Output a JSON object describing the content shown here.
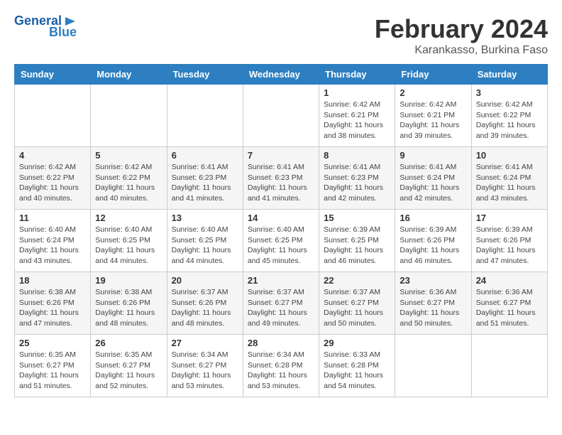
{
  "header": {
    "logo_line1": "General",
    "logo_line2": "Blue",
    "title": "February 2024",
    "subtitle": "Karankasso, Burkina Faso"
  },
  "weekdays": [
    "Sunday",
    "Monday",
    "Tuesday",
    "Wednesday",
    "Thursday",
    "Friday",
    "Saturday"
  ],
  "weeks": [
    [
      {
        "day": "",
        "info": ""
      },
      {
        "day": "",
        "info": ""
      },
      {
        "day": "",
        "info": ""
      },
      {
        "day": "",
        "info": ""
      },
      {
        "day": "1",
        "info": "Sunrise: 6:42 AM\nSunset: 6:21 PM\nDaylight: 11 hours\nand 38 minutes."
      },
      {
        "day": "2",
        "info": "Sunrise: 6:42 AM\nSunset: 6:21 PM\nDaylight: 11 hours\nand 39 minutes."
      },
      {
        "day": "3",
        "info": "Sunrise: 6:42 AM\nSunset: 6:22 PM\nDaylight: 11 hours\nand 39 minutes."
      }
    ],
    [
      {
        "day": "4",
        "info": "Sunrise: 6:42 AM\nSunset: 6:22 PM\nDaylight: 11 hours\nand 40 minutes."
      },
      {
        "day": "5",
        "info": "Sunrise: 6:42 AM\nSunset: 6:22 PM\nDaylight: 11 hours\nand 40 minutes."
      },
      {
        "day": "6",
        "info": "Sunrise: 6:41 AM\nSunset: 6:23 PM\nDaylight: 11 hours\nand 41 minutes."
      },
      {
        "day": "7",
        "info": "Sunrise: 6:41 AM\nSunset: 6:23 PM\nDaylight: 11 hours\nand 41 minutes."
      },
      {
        "day": "8",
        "info": "Sunrise: 6:41 AM\nSunset: 6:23 PM\nDaylight: 11 hours\nand 42 minutes."
      },
      {
        "day": "9",
        "info": "Sunrise: 6:41 AM\nSunset: 6:24 PM\nDaylight: 11 hours\nand 42 minutes."
      },
      {
        "day": "10",
        "info": "Sunrise: 6:41 AM\nSunset: 6:24 PM\nDaylight: 11 hours\nand 43 minutes."
      }
    ],
    [
      {
        "day": "11",
        "info": "Sunrise: 6:40 AM\nSunset: 6:24 PM\nDaylight: 11 hours\nand 43 minutes."
      },
      {
        "day": "12",
        "info": "Sunrise: 6:40 AM\nSunset: 6:25 PM\nDaylight: 11 hours\nand 44 minutes."
      },
      {
        "day": "13",
        "info": "Sunrise: 6:40 AM\nSunset: 6:25 PM\nDaylight: 11 hours\nand 44 minutes."
      },
      {
        "day": "14",
        "info": "Sunrise: 6:40 AM\nSunset: 6:25 PM\nDaylight: 11 hours\nand 45 minutes."
      },
      {
        "day": "15",
        "info": "Sunrise: 6:39 AM\nSunset: 6:25 PM\nDaylight: 11 hours\nand 46 minutes."
      },
      {
        "day": "16",
        "info": "Sunrise: 6:39 AM\nSunset: 6:26 PM\nDaylight: 11 hours\nand 46 minutes."
      },
      {
        "day": "17",
        "info": "Sunrise: 6:39 AM\nSunset: 6:26 PM\nDaylight: 11 hours\nand 47 minutes."
      }
    ],
    [
      {
        "day": "18",
        "info": "Sunrise: 6:38 AM\nSunset: 6:26 PM\nDaylight: 11 hours\nand 47 minutes."
      },
      {
        "day": "19",
        "info": "Sunrise: 6:38 AM\nSunset: 6:26 PM\nDaylight: 11 hours\nand 48 minutes."
      },
      {
        "day": "20",
        "info": "Sunrise: 6:37 AM\nSunset: 6:26 PM\nDaylight: 11 hours\nand 48 minutes."
      },
      {
        "day": "21",
        "info": "Sunrise: 6:37 AM\nSunset: 6:27 PM\nDaylight: 11 hours\nand 49 minutes."
      },
      {
        "day": "22",
        "info": "Sunrise: 6:37 AM\nSunset: 6:27 PM\nDaylight: 11 hours\nand 50 minutes."
      },
      {
        "day": "23",
        "info": "Sunrise: 6:36 AM\nSunset: 6:27 PM\nDaylight: 11 hours\nand 50 minutes."
      },
      {
        "day": "24",
        "info": "Sunrise: 6:36 AM\nSunset: 6:27 PM\nDaylight: 11 hours\nand 51 minutes."
      }
    ],
    [
      {
        "day": "25",
        "info": "Sunrise: 6:35 AM\nSunset: 6:27 PM\nDaylight: 11 hours\nand 51 minutes."
      },
      {
        "day": "26",
        "info": "Sunrise: 6:35 AM\nSunset: 6:27 PM\nDaylight: 11 hours\nand 52 minutes."
      },
      {
        "day": "27",
        "info": "Sunrise: 6:34 AM\nSunset: 6:27 PM\nDaylight: 11 hours\nand 53 minutes."
      },
      {
        "day": "28",
        "info": "Sunrise: 6:34 AM\nSunset: 6:28 PM\nDaylight: 11 hours\nand 53 minutes."
      },
      {
        "day": "29",
        "info": "Sunrise: 6:33 AM\nSunset: 6:28 PM\nDaylight: 11 hours\nand 54 minutes."
      },
      {
        "day": "",
        "info": ""
      },
      {
        "day": "",
        "info": ""
      }
    ]
  ]
}
